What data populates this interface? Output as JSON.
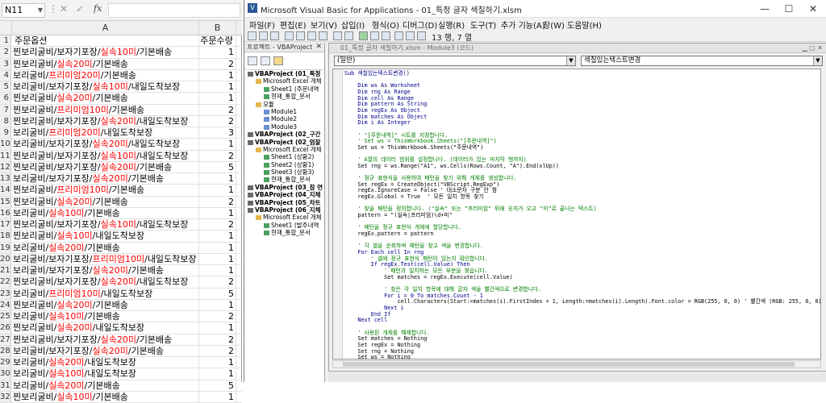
{
  "excel": {
    "name_box": "N11",
    "fx": "fx",
    "col_a": "A",
    "col_b": "B",
    "rows": [
      {
        "n": "1",
        "parts": [
          {
            "t": "주문옵션",
            "r": false
          }
        ],
        "b": "주문수량"
      },
      {
        "n": "2",
        "parts": [
          {
            "t": "찐보리굴비/보자기포장/",
            "r": false
          },
          {
            "t": "실속10미",
            "r": true
          },
          {
            "t": "/기본배송",
            "r": false
          }
        ],
        "b": "1"
      },
      {
        "n": "3",
        "parts": [
          {
            "t": "찐보리굴비/",
            "r": false
          },
          {
            "t": "실속20미",
            "r": true
          },
          {
            "t": "/기본배송",
            "r": false
          }
        ],
        "b": "2"
      },
      {
        "n": "4",
        "parts": [
          {
            "t": "보리굴비/",
            "r": false
          },
          {
            "t": "프리미엄20미",
            "r": true
          },
          {
            "t": "/기본배송",
            "r": false
          }
        ],
        "b": "1"
      },
      {
        "n": "5",
        "parts": [
          {
            "t": "보리굴비/보자기포장/",
            "r": false
          },
          {
            "t": "실속10미",
            "r": true
          },
          {
            "t": "/내일도착보장",
            "r": false
          }
        ],
        "b": "1"
      },
      {
        "n": "6",
        "parts": [
          {
            "t": "찐보리굴비/",
            "r": false
          },
          {
            "t": "실속20미",
            "r": true
          },
          {
            "t": "/기본배송",
            "r": false
          }
        ],
        "b": "1"
      },
      {
        "n": "7",
        "parts": [
          {
            "t": "찐보리굴비/",
            "r": false
          },
          {
            "t": "프리미엄10미",
            "r": true
          },
          {
            "t": "/기본배송",
            "r": false
          }
        ],
        "b": "2"
      },
      {
        "n": "8",
        "parts": [
          {
            "t": "찐보리굴비/보자기포장/",
            "r": false
          },
          {
            "t": "실속20미",
            "r": true
          },
          {
            "t": "/내일도착보장",
            "r": false
          }
        ],
        "b": "2"
      },
      {
        "n": "9",
        "parts": [
          {
            "t": "보리굴비/",
            "r": false
          },
          {
            "t": "프리미엄20미",
            "r": true
          },
          {
            "t": "/내일도착보장",
            "r": false
          }
        ],
        "b": "3"
      },
      {
        "n": "10",
        "parts": [
          {
            "t": "보리굴비/보자기포장/",
            "r": false
          },
          {
            "t": "실속20미",
            "r": true
          },
          {
            "t": "/내일도착보장",
            "r": false
          }
        ],
        "b": "1"
      },
      {
        "n": "11",
        "parts": [
          {
            "t": "찐보리굴비/보자기포장/",
            "r": false
          },
          {
            "t": "실속10미",
            "r": true
          },
          {
            "t": "/내일도착보장",
            "r": false
          }
        ],
        "b": "2"
      },
      {
        "n": "12",
        "parts": [
          {
            "t": "찐보리굴비/보자기포장/",
            "r": false
          },
          {
            "t": "실속20미",
            "r": true
          },
          {
            "t": "/기본배송",
            "r": false
          }
        ],
        "b": "5"
      },
      {
        "n": "13",
        "parts": [
          {
            "t": "보리굴비/보자기포장/",
            "r": false
          },
          {
            "t": "실속20미",
            "r": true
          },
          {
            "t": "/기본배송",
            "r": false
          }
        ],
        "b": "1"
      },
      {
        "n": "14",
        "parts": [
          {
            "t": "찐보리굴비/",
            "r": false
          },
          {
            "t": "프리미엄10미",
            "r": true
          },
          {
            "t": "/기본배송",
            "r": false
          }
        ],
        "b": "1"
      },
      {
        "n": "15",
        "parts": [
          {
            "t": "찐보리굴비/",
            "r": false
          },
          {
            "t": "실속20미",
            "r": true
          },
          {
            "t": "/기본배송",
            "r": false
          }
        ],
        "b": "2"
      },
      {
        "n": "16",
        "parts": [
          {
            "t": "보리굴비/",
            "r": false
          },
          {
            "t": "실속10미",
            "r": true
          },
          {
            "t": "/기본배송",
            "r": false
          }
        ],
        "b": "1"
      },
      {
        "n": "17",
        "parts": [
          {
            "t": "찐보리굴비/보자기포장/",
            "r": false
          },
          {
            "t": "실속10미",
            "r": true
          },
          {
            "t": "/내일도착보장",
            "r": false
          }
        ],
        "b": "2"
      },
      {
        "n": "18",
        "parts": [
          {
            "t": "찐보리굴비/",
            "r": false
          },
          {
            "t": "실속10미",
            "r": true
          },
          {
            "t": "/내일도착보장",
            "r": false
          }
        ],
        "b": "1"
      },
      {
        "n": "19",
        "parts": [
          {
            "t": "보리굴비/",
            "r": false
          },
          {
            "t": "실속20미",
            "r": true
          },
          {
            "t": "/기본배송",
            "r": false
          }
        ],
        "b": "1"
      },
      {
        "n": "20",
        "parts": [
          {
            "t": "보리굴비/보자기포장/",
            "r": false
          },
          {
            "t": "프리미엄10미",
            "r": true
          },
          {
            "t": "/내일도착보장",
            "r": false
          }
        ],
        "b": "1"
      },
      {
        "n": "21",
        "parts": [
          {
            "t": "보리굴비/보자기포장/",
            "r": false
          },
          {
            "t": "실속20미",
            "r": true
          },
          {
            "t": "/기본배송",
            "r": false
          }
        ],
        "b": "1"
      },
      {
        "n": "22",
        "parts": [
          {
            "t": "찐보리굴비/보자기포장/",
            "r": false
          },
          {
            "t": "실속20미",
            "r": true
          },
          {
            "t": "/내일도착보장",
            "r": false
          }
        ],
        "b": "2"
      },
      {
        "n": "23",
        "parts": [
          {
            "t": "보리굴비/",
            "r": false
          },
          {
            "t": "프리미엄10미",
            "r": true
          },
          {
            "t": "/내일도착보장",
            "r": false
          }
        ],
        "b": "5"
      },
      {
        "n": "24",
        "parts": [
          {
            "t": "찐보리굴비/",
            "r": false
          },
          {
            "t": "실속20미",
            "r": true
          },
          {
            "t": "/기본배송",
            "r": false
          }
        ],
        "b": "1"
      },
      {
        "n": "25",
        "parts": [
          {
            "t": "보리굴비/",
            "r": false
          },
          {
            "t": "실속10미",
            "r": true
          },
          {
            "t": "/기본배송",
            "r": false
          }
        ],
        "b": "2"
      },
      {
        "n": "26",
        "parts": [
          {
            "t": "찐보리굴비/",
            "r": false
          },
          {
            "t": "실속20미",
            "r": true
          },
          {
            "t": "/내일도착보장",
            "r": false
          }
        ],
        "b": "1"
      },
      {
        "n": "27",
        "parts": [
          {
            "t": "찐보리굴비/보자기포장/",
            "r": false
          },
          {
            "t": "실속20미",
            "r": true
          },
          {
            "t": "/기본배송",
            "r": false
          }
        ],
        "b": "2"
      },
      {
        "n": "28",
        "parts": [
          {
            "t": "보리굴비/보자기포장/",
            "r": false
          },
          {
            "t": "실속20미",
            "r": true
          },
          {
            "t": "/기본배송",
            "r": false
          }
        ],
        "b": "2"
      },
      {
        "n": "29",
        "parts": [
          {
            "t": "보리굴비/",
            "r": false
          },
          {
            "t": "실속20미",
            "r": true
          },
          {
            "t": "/내일도착보장",
            "r": false
          }
        ],
        "b": "1"
      },
      {
        "n": "30",
        "parts": [
          {
            "t": "보리굴비/",
            "r": false
          },
          {
            "t": "실속10미",
            "r": true
          },
          {
            "t": "/내일도착보장",
            "r": false
          }
        ],
        "b": "1"
      },
      {
        "n": "31",
        "parts": [
          {
            "t": "보리굴비/",
            "r": false
          },
          {
            "t": "실속20미",
            "r": true
          },
          {
            "t": "/기본배송",
            "r": false
          }
        ],
        "b": "5"
      },
      {
        "n": "32",
        "parts": [
          {
            "t": "찐보리굴비/",
            "r": false
          },
          {
            "t": "실속10미",
            "r": true
          },
          {
            "t": "/기본배송",
            "r": false
          }
        ],
        "b": "1"
      }
    ]
  },
  "vbe": {
    "title": "Microsoft Visual Basic for Applications - 01_특정 글자 색칠하기.xlsm",
    "menus": [
      "파일(F)",
      "편집(E)",
      "보기(V)",
      "삽입(I)",
      "형식(O)",
      "디버그(D)",
      "실행(R)",
      "도구(T)",
      "추가 기능(A)",
      "창(W)",
      "도움말(H)"
    ],
    "cursor_pos": "13 행, 7 열",
    "project_title": "프로젝트 - VBAProject",
    "tree": [
      {
        "t": "VBAProject (01_특정",
        "lvl": 0,
        "ic": "proj-ic",
        "b": true
      },
      {
        "t": "Microsoft Excel 개체",
        "lvl": 1,
        "ic": "folder",
        "b": false
      },
      {
        "t": "Sheet1 (주문내역",
        "lvl": 2,
        "ic": "sheet",
        "b": false
      },
      {
        "t": "현재_통합_문서",
        "lvl": 2,
        "ic": "sheet",
        "b": false
      },
      {
        "t": "모듈",
        "lvl": 1,
        "ic": "folder",
        "b": false
      },
      {
        "t": "Module1",
        "lvl": 2,
        "ic": "mod",
        "b": false
      },
      {
        "t": "Module2",
        "lvl": 2,
        "ic": "mod",
        "b": false
      },
      {
        "t": "Module3",
        "lvl": 2,
        "ic": "mod",
        "b": false
      },
      {
        "t": "VBAProject (02_구간",
        "lvl": 0,
        "ic": "proj-ic",
        "b": true
      },
      {
        "t": "VBAProject (02_엄잘",
        "lvl": 0,
        "ic": "proj-ic",
        "b": true
      },
      {
        "t": "Microsoft Excel 개체",
        "lvl": 1,
        "ic": "folder",
        "b": false
      },
      {
        "t": "Sheet1 (상황2)",
        "lvl": 2,
        "ic": "sheet",
        "b": false
      },
      {
        "t": "Sheet2 (상황1)",
        "lvl": 2,
        "ic": "sheet",
        "b": false
      },
      {
        "t": "Sheet3 (상황3)",
        "lvl": 2,
        "ic": "sheet",
        "b": false
      },
      {
        "t": "현재_통합_문서",
        "lvl": 2,
        "ic": "sheet",
        "b": false
      },
      {
        "t": "VBAProject (03_참 연",
        "lvl": 0,
        "ic": "proj-ic",
        "b": true
      },
      {
        "t": "VBAProject (04_지체",
        "lvl": 0,
        "ic": "proj-ic",
        "b": true
      },
      {
        "t": "VBAProject (05_차트",
        "lvl": 0,
        "ic": "proj-ic",
        "b": true
      },
      {
        "t": "VBAProject (06_지체",
        "lvl": 0,
        "ic": "proj-ic",
        "b": true
      },
      {
        "t": "Microsoft Excel 개체",
        "lvl": 1,
        "ic": "folder",
        "b": false
      },
      {
        "t": "Sheet1 (발주내역",
        "lvl": 2,
        "ic": "sheet",
        "b": false
      },
      {
        "t": "현재_통합_문서",
        "lvl": 2,
        "ic": "sheet",
        "b": false
      }
    ],
    "code_title": "01_특정 글자 색칠하기.xlsm - Module3 (코드)",
    "combo_left": "(일반)",
    "combo_right": "색칠있는텍스트변경",
    "code_lines": [
      {
        "t": "Sub 색칠있는텍스트변경()",
        "c": "kw"
      },
      {
        "t": "",
        "c": ""
      },
      {
        "t": "    Dim ws As Worksheet",
        "c": "kw"
      },
      {
        "t": "    Dim rng As Range",
        "c": "kw"
      },
      {
        "t": "    Dim cell As Range",
        "c": "kw"
      },
      {
        "t": "    Dim pattern As String",
        "c": "kw"
      },
      {
        "t": "    Dim regEx As Object",
        "c": "kw"
      },
      {
        "t": "    Dim matches As Object",
        "c": "kw"
      },
      {
        "t": "    Dim i As Integer",
        "c": "kw"
      },
      {
        "t": "",
        "c": ""
      },
      {
        "t": "    ' \"[주문내역]\" 시트를 지정합니다.",
        "c": "cm"
      },
      {
        "t": "    ' Set ws = ThisWorkbook.Sheets(\"[주문내역]\")",
        "c": "cm"
      },
      {
        "t": "    Set ws = ThisWorkbook.Sheets(\"주문내역\")",
        "c": ""
      },
      {
        "t": "",
        "c": ""
      },
      {
        "t": "    ' A열의 데이터 범위를 설정합니다. (데이터가 있는 마지막 행까지)",
        "c": "cm"
      },
      {
        "t": "    Set rng = ws.Range(\"A1\", ws.Cells(Rows.Count, \"A\").End(xlUp))",
        "c": ""
      },
      {
        "t": "",
        "c": ""
      },
      {
        "t": "    ' 정규 표현식을 사용하여 패턴을 찾기 위해 개체를 생성합니다.",
        "c": "cm"
      },
      {
        "t": "    Set regEx = CreateObject(\"VBScript.RegExp\")",
        "c": ""
      },
      {
        "t": "    regEx.IgnoreCase = False ' 대소문자 구분 안 함",
        "c": ""
      },
      {
        "t": "    regEx.Global = True  ' 모든 일치 항목 찾기",
        "c": ""
      },
      {
        "t": "",
        "c": ""
      },
      {
        "t": "    ' 찾을 패턴을 정의합니다. (\"실속\" 또는 \"프리미엄\" 뒤에 숫자가 오고 \"미\"로 끝나는 텍스트)",
        "c": "cm"
      },
      {
        "t": "    pattern = \"(실속|프리미엄)\\d+미\"",
        "c": ""
      },
      {
        "t": "",
        "c": ""
      },
      {
        "t": "    ' 패턴을 정규 표현식 개체에 할당합니다.",
        "c": "cm"
      },
      {
        "t": "    regEx.pattern = pattern",
        "c": ""
      },
      {
        "t": "",
        "c": ""
      },
      {
        "t": "    ' 각 셀을 순회하며 패턴을 찾고 색을 변경합니다.",
        "c": "cm"
      },
      {
        "t": "    For Each cell In rng",
        "c": "kw"
      },
      {
        "t": "        ' 셀에 정규 표현식 패턴이 있는지 확인합니다.",
        "c": "cm"
      },
      {
        "t": "        If regEx.Test(cell.Value) Then",
        "c": "kw"
      },
      {
        "t": "            ' 패턴과 일치하는 모든 부분을 찾습니다.",
        "c": "cm"
      },
      {
        "t": "            Set matches = regEx.Execute(cell.Value)",
        "c": ""
      },
      {
        "t": "",
        "c": ""
      },
      {
        "t": "            ' 찾은 각 일치 항목에 대해 글자 색을 빨간색으로 변경합니다.",
        "c": "cm"
      },
      {
        "t": "            For i = 0 To matches.Count - 1",
        "c": "kw"
      },
      {
        "t": "                cell.Characters(Start:=matches(i).FirstIndex + 1, Length:=matches(i).Length).Font.color = RGB(255, 0, 0) ' 빨간색 (RGB: 255, 0, 0)",
        "c": ""
      },
      {
        "t": "            Next i",
        "c": "kw"
      },
      {
        "t": "        End If",
        "c": "kw"
      },
      {
        "t": "    Next cell",
        "c": "kw"
      },
      {
        "t": "",
        "c": ""
      },
      {
        "t": "    ' 사용된 개체를 해제합니다.",
        "c": "cm"
      },
      {
        "t": "    Set matches = Nothing",
        "c": ""
      },
      {
        "t": "    Set regEx = Nothing",
        "c": ""
      },
      {
        "t": "    Set rng = Nothing",
        "c": ""
      },
      {
        "t": "    Set ws = Nothing",
        "c": ""
      },
      {
        "t": "",
        "c": ""
      },
      {
        "t": "    MsgBox \"지정된 텍스트의 색상 변경이 완료되었습니다.\", vbInformation",
        "c": ""
      }
    ]
  }
}
